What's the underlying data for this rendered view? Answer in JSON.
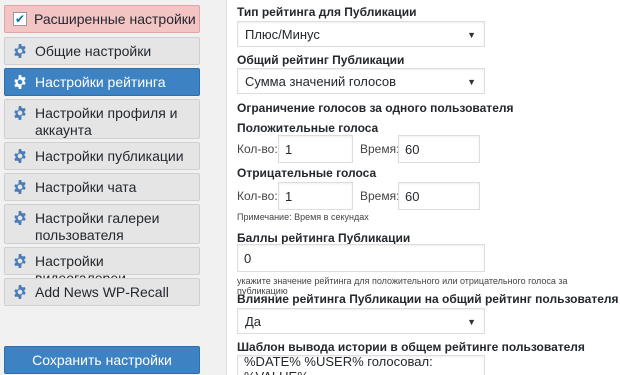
{
  "sidebar": {
    "advanced_toggle": {
      "label": "Расширенные настройки",
      "checked": true
    },
    "items": [
      {
        "label": "Общие настройки",
        "active": false
      },
      {
        "label": "Настройки рейтинга",
        "active": true
      },
      {
        "label": "Настройки профиля и аккаунта",
        "active": false
      },
      {
        "label": "Настройки публикации",
        "active": false
      },
      {
        "label": "Настройки чата",
        "active": false
      },
      {
        "label": "Настройки галереи пользователя",
        "active": false
      },
      {
        "label": "Настройки видеогалереи",
        "active": false
      },
      {
        "label": "Add News WP-Recall",
        "active": false
      }
    ],
    "save_label": "Сохранить настройки"
  },
  "form": {
    "rating_type": {
      "label": "Тип рейтинга для Публикации",
      "value": "Плюс/Минус"
    },
    "overall_rating": {
      "label": "Общий рейтинг Публикации",
      "value": "Сумма значений голосов"
    },
    "vote_limit": {
      "label": "Ограничение голосов за одного пользователя",
      "positive": {
        "label": "Положительные голоса",
        "count_label": "Кол-во:",
        "count": "1",
        "time_label": "Время:",
        "time": "60"
      },
      "negative": {
        "label": "Отрицательные голоса",
        "count_label": "Кол-во:",
        "count": "1",
        "time_label": "Время:",
        "time": "60"
      },
      "note": "Примечание: Время в секундах"
    },
    "points": {
      "label": "Баллы рейтинга Публикации",
      "value": "0",
      "note": "укажите значение рейтинга для положительного или отрицательного голоса за публикацию"
    },
    "influence": {
      "label": "Влияние рейтинга Публикации на общий рейтинг пользователя",
      "value": "Да"
    },
    "history_template": {
      "label": "Шаблон вывода истории в общем рейтинге пользователя",
      "value": "%DATE% %USER% голосовал: %VALUE%"
    }
  },
  "colors": {
    "accent": "#3d83c3",
    "advanced_bg": "#f2c4c4"
  }
}
